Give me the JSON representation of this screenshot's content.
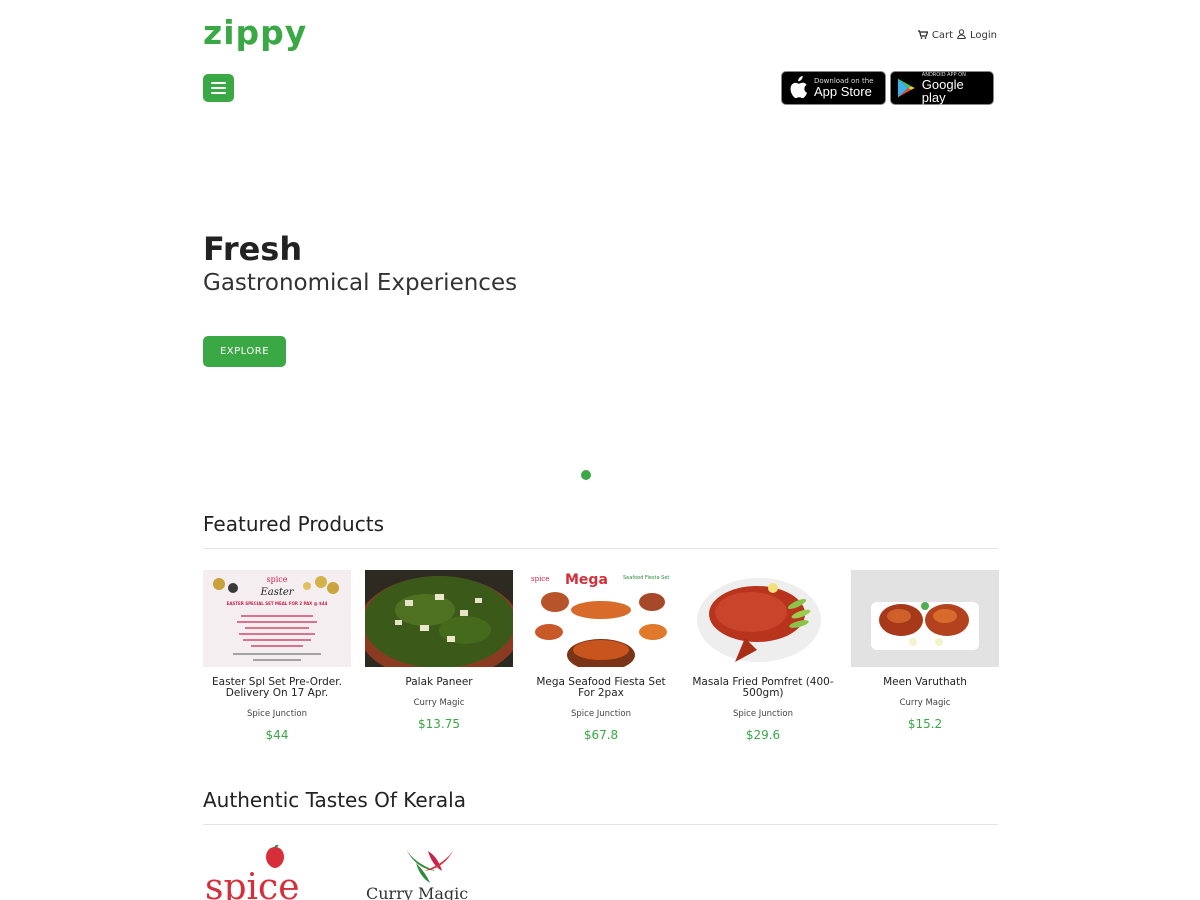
{
  "header": {
    "logo": "zippy",
    "cart_label": "Cart",
    "login_label": "Login",
    "app_store": {
      "small": "Download on the",
      "large": "App Store"
    },
    "google_play": {
      "small": "ANDROID APP ON",
      "large": "Google play"
    }
  },
  "hero": {
    "title": "Fresh",
    "subtitle": "Gastronomical Experiences",
    "button_label": "EXPLORE"
  },
  "featured": {
    "title": "Featured Products",
    "items": [
      {
        "name": "Easter Spl Set Pre-Order. Delivery On 17 Apr.",
        "store": "Spice Junction",
        "price": "$44",
        "image": "easter-menu-image"
      },
      {
        "name": "Palak Paneer",
        "store": "Curry Magic",
        "price": "$13.75",
        "image": "palak-paneer-image"
      },
      {
        "name": "Mega Seafood Fiesta Set For 2pax",
        "store": "Spice Junction",
        "price": "$67.8",
        "image": "seafood-fiesta-image"
      },
      {
        "name": "Masala Fried Pomfret (400-500gm)",
        "store": "Spice Junction",
        "price": "$29.6",
        "image": "pomfret-image"
      },
      {
        "name": "Meen Varuthath",
        "store": "Curry Magic",
        "price": "$15.2",
        "image": "meen-varuthath-image"
      }
    ],
    "image_text": {
      "easter_brand": "spice",
      "easter_title": "Easter",
      "easter_offer": "EASTER SPECIAL SET MEAL FOR 2 PAX @ $44",
      "seafood_brand": "spice",
      "seafood_mega": "Mega",
      "seafood_fiesta": "Seafood Fiesta Set"
    }
  },
  "kerala": {
    "title": "Authentic Tastes Of Kerala",
    "brands": [
      {
        "name": "spice",
        "logo": "spice-junction-logo"
      },
      {
        "name": "Curry Magic",
        "logo": "curry-magic-logo"
      }
    ]
  },
  "colors": {
    "brand_green": "#3aa845"
  }
}
